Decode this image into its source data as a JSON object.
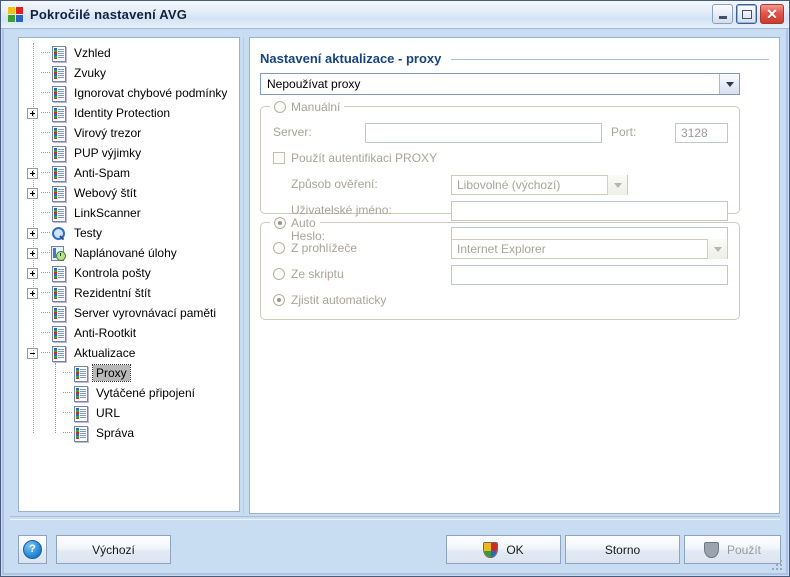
{
  "window": {
    "title": "Pokročilé nastavení AVG",
    "icon": "avg-logo-icon",
    "minimize_label": "–",
    "restore_label": "❐",
    "close_label": "✕"
  },
  "tree": {
    "items": [
      {
        "label": "Vzhled",
        "level": 1,
        "expander": "none",
        "icon": "document-icon"
      },
      {
        "label": "Zvuky",
        "level": 1,
        "expander": "none",
        "icon": "document-icon"
      },
      {
        "label": "Ignorovat chybové podmínky",
        "level": 1,
        "expander": "none",
        "icon": "document-icon"
      },
      {
        "label": "Identity Protection",
        "level": 1,
        "expander": "plus",
        "icon": "document-icon"
      },
      {
        "label": "Virový trezor",
        "level": 1,
        "expander": "none",
        "icon": "document-icon"
      },
      {
        "label": "PUP výjimky",
        "level": 1,
        "expander": "none",
        "icon": "document-icon"
      },
      {
        "label": "Anti-Spam",
        "level": 1,
        "expander": "plus",
        "icon": "document-icon"
      },
      {
        "label": "Webový štít",
        "level": 1,
        "expander": "plus",
        "icon": "document-icon"
      },
      {
        "label": "LinkScanner",
        "level": 1,
        "expander": "none",
        "icon": "document-icon"
      },
      {
        "label": "Testy",
        "level": 1,
        "expander": "plus",
        "icon": "search-icon"
      },
      {
        "label": "Naplánované úlohy",
        "level": 1,
        "expander": "plus",
        "icon": "scheduled-task-icon"
      },
      {
        "label": "Kontrola pošty",
        "level": 1,
        "expander": "plus",
        "icon": "document-icon"
      },
      {
        "label": "Rezidentní štít",
        "level": 1,
        "expander": "plus",
        "icon": "document-icon"
      },
      {
        "label": "Server vyrovnávací paměti",
        "level": 1,
        "expander": "none",
        "icon": "document-icon"
      },
      {
        "label": "Anti-Rootkit",
        "level": 1,
        "expander": "none",
        "icon": "document-icon"
      },
      {
        "label": "Aktualizace",
        "level": 1,
        "expander": "minus",
        "icon": "document-icon"
      },
      {
        "label": "Proxy",
        "level": 2,
        "expander": "none",
        "icon": "document-icon",
        "selected": true
      },
      {
        "label": "Vytáčené připojení",
        "level": 2,
        "expander": "none",
        "icon": "document-icon"
      },
      {
        "label": "URL",
        "level": 2,
        "expander": "none",
        "icon": "document-icon"
      },
      {
        "label": "Správa",
        "level": 2,
        "expander": "none",
        "icon": "document-icon"
      }
    ]
  },
  "content": {
    "page_title": "Nastavení aktualizace - proxy",
    "proxy_mode": {
      "selected": "Nepoužívat proxy",
      "options": [
        "Nepoužívat proxy",
        "Manuální",
        "Auto"
      ]
    },
    "manual_group": {
      "title": "Manuální",
      "radio_checked": false,
      "server_label": "Server:",
      "server_value": "",
      "port_label": "Port:",
      "port_value": "3128",
      "auth_checkbox_label": "Použít autentifikaci PROXY",
      "auth_checkbox_checked": false,
      "auth_method_label": "Způsob ověření:",
      "auth_method_value": "Libovolné (výchozí)",
      "username_label": "Uživatelské jméno:",
      "username_value": "",
      "password_label": "Heslo:",
      "password_value": ""
    },
    "auto_group": {
      "title": "Auto",
      "radio_checked": true,
      "from_browser_label": "Z prohlížeče",
      "from_browser_checked": false,
      "browser_value": "Internet Explorer",
      "from_script_label": "Ze skriptu",
      "from_script_checked": false,
      "script_value": "",
      "auto_detect_label": "Zjistit automaticky",
      "auto_detect_checked": true
    }
  },
  "footer": {
    "help_label": "?",
    "default_label": "Výchozí",
    "ok_label": "OK",
    "cancel_label": "Storno",
    "apply_label": "Použít",
    "apply_enabled": false
  },
  "colors": {
    "window_background": "#c9ddf2",
    "title_accent": "#17447e",
    "selection": "#b8b8b8",
    "close_button": "#cc3b30"
  }
}
